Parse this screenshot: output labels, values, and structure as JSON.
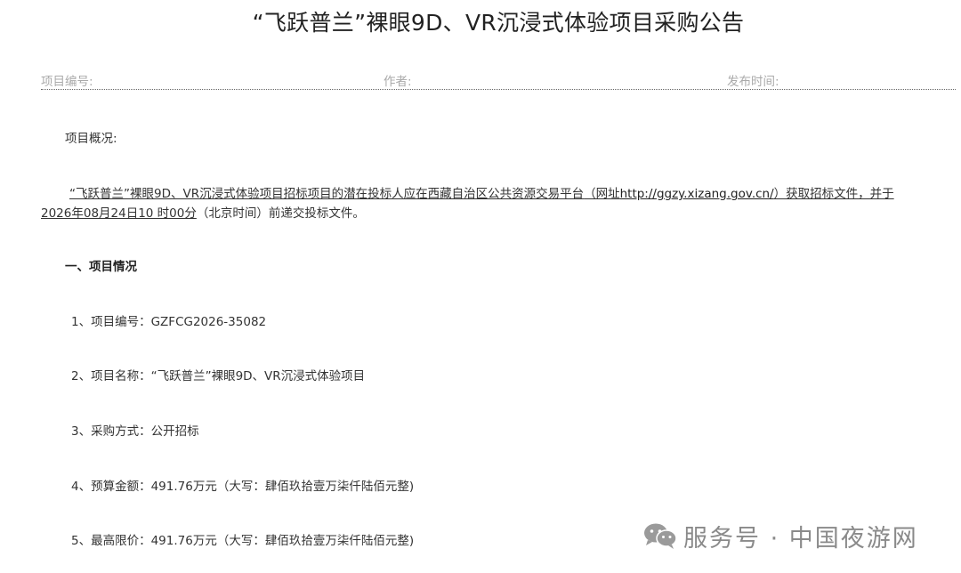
{
  "title": "“飞跃普兰”裸眼9D、VR沉浸式体验项目采购公告",
  "meta": {
    "project_no_label": "项目编号:",
    "author_label": "作者:",
    "publish_time_label": "发布时间:"
  },
  "overview_label": "项目概况:",
  "intro": {
    "part1": "“飞跃普兰”裸眼9D、VR沉浸式体验项目招标项目的潜在投标人应在",
    "platform": "西藏自治区公共资源交易平台",
    "part2": "（网址",
    "url": "http://ggzy.xizang.gov.cn/",
    "part3": "）获取招标文件，并于",
    "deadline": "2026年08月24日10 时00分",
    "part4": "（北京时间）前递交投标文件。"
  },
  "section1_heading": "一、项目情况",
  "items": [
    "1、项目编号：GZFCG2026-35082",
    "2、项目名称：“飞跃普兰”裸眼9D、VR沉浸式体验项目",
    "3、采购方式：公开招标",
    "4、预算金额：491.76万元（大写：肆佰玖拾壹万柒仟陆佰元整)",
    "5、最高限价：491.76万元（大写：肆佰玖拾壹万柒仟陆佰元整)"
  ],
  "watermark": {
    "text": "服务号 · 中国夜游网",
    "icon": "wechat-icon"
  }
}
